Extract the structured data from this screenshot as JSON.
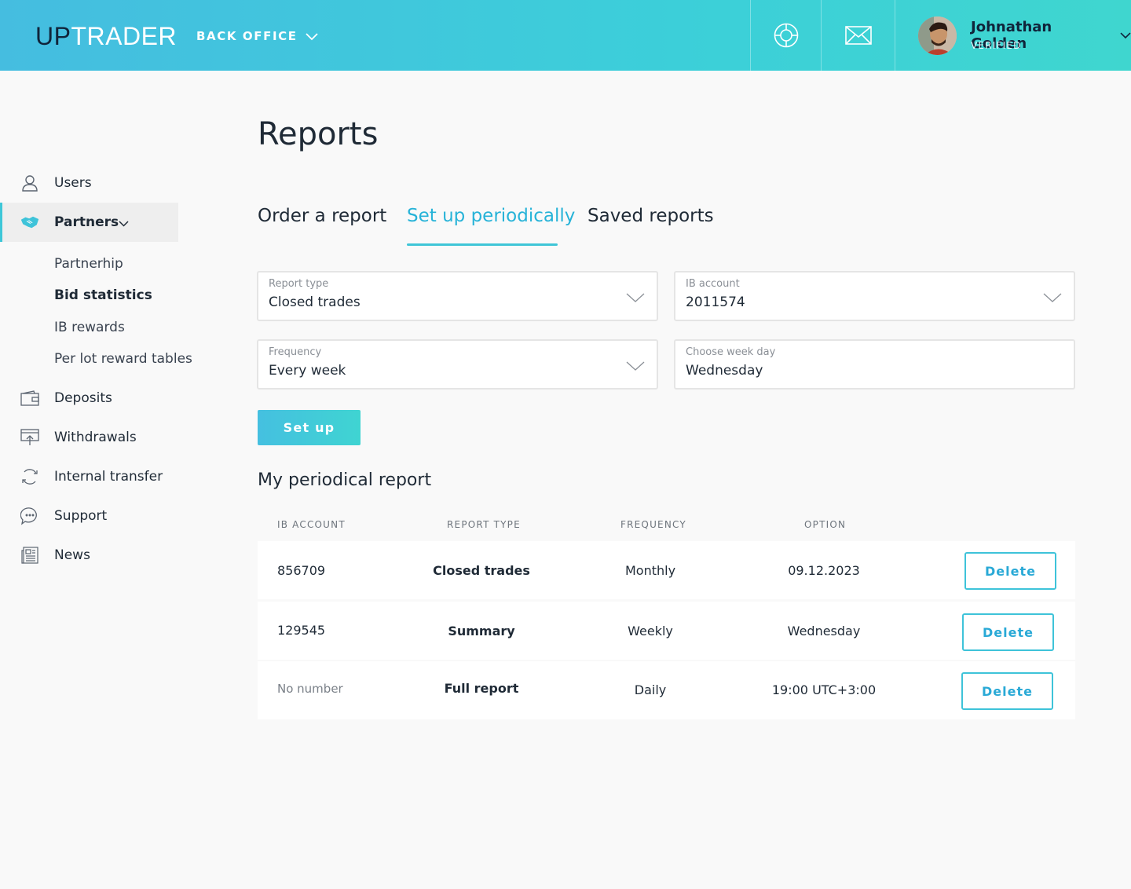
{
  "header": {
    "logo_up": "UP",
    "logo_trader": "TRADER",
    "menu_label": "BACK OFFICE",
    "icons": [
      "lifebuoy-icon",
      "envelope-icon"
    ],
    "user": {
      "name": "Johnathan Golden",
      "status": "VERIFIED"
    }
  },
  "sidebar": {
    "items": [
      {
        "label": "Users",
        "icon": "user-icon"
      },
      {
        "label": "Partners",
        "icon": "handshake-icon",
        "active": true
      },
      {
        "label": "Deposits",
        "icon": "wallet-icon"
      },
      {
        "label": "Withdrawals",
        "icon": "withdraw-icon"
      },
      {
        "label": "Internal transfer",
        "icon": "transfer-icon"
      },
      {
        "label": "Support",
        "icon": "chat-icon"
      },
      {
        "label": "News",
        "icon": "newspaper-icon"
      }
    ],
    "partners_sub": [
      "Partnerhip",
      "Bid statistics",
      "IB rewards",
      "Per lot reward tables"
    ]
  },
  "main": {
    "title": "Reports",
    "tabs": [
      {
        "label": "Order a report"
      },
      {
        "label": "Set up periodically",
        "active": true
      },
      {
        "label": "Saved reports"
      }
    ],
    "form": {
      "report_type": {
        "label": "Report type",
        "value": "Closed trades"
      },
      "ib_account": {
        "label": "IB account",
        "value": "2011574"
      },
      "frequency": {
        "label": "Frequency",
        "value": "Every week"
      },
      "week_day": {
        "label": "Choose week day",
        "value": "Wednesday"
      },
      "submit_label": "Set up"
    },
    "table": {
      "title": "My periodical report",
      "headers": [
        "IB ACCOUNT",
        "REPORT TYPE",
        "FREQUENCY",
        "OPTION"
      ],
      "delete_label": "Delete",
      "rows": [
        {
          "account": "856709",
          "type": "Closed trades",
          "frequency": "Monthly",
          "option": "09.12.2023"
        },
        {
          "account": "129545",
          "type": "Summary",
          "frequency": "Weekly",
          "option": "Wednesday"
        },
        {
          "account": "No number",
          "type": "Full report",
          "frequency": "Daily",
          "option": "19:00 UTC+3:00"
        }
      ]
    }
  },
  "colors": {
    "accent": "#3ec7d8",
    "link": "#27b3d8",
    "dark": "#10243a"
  }
}
